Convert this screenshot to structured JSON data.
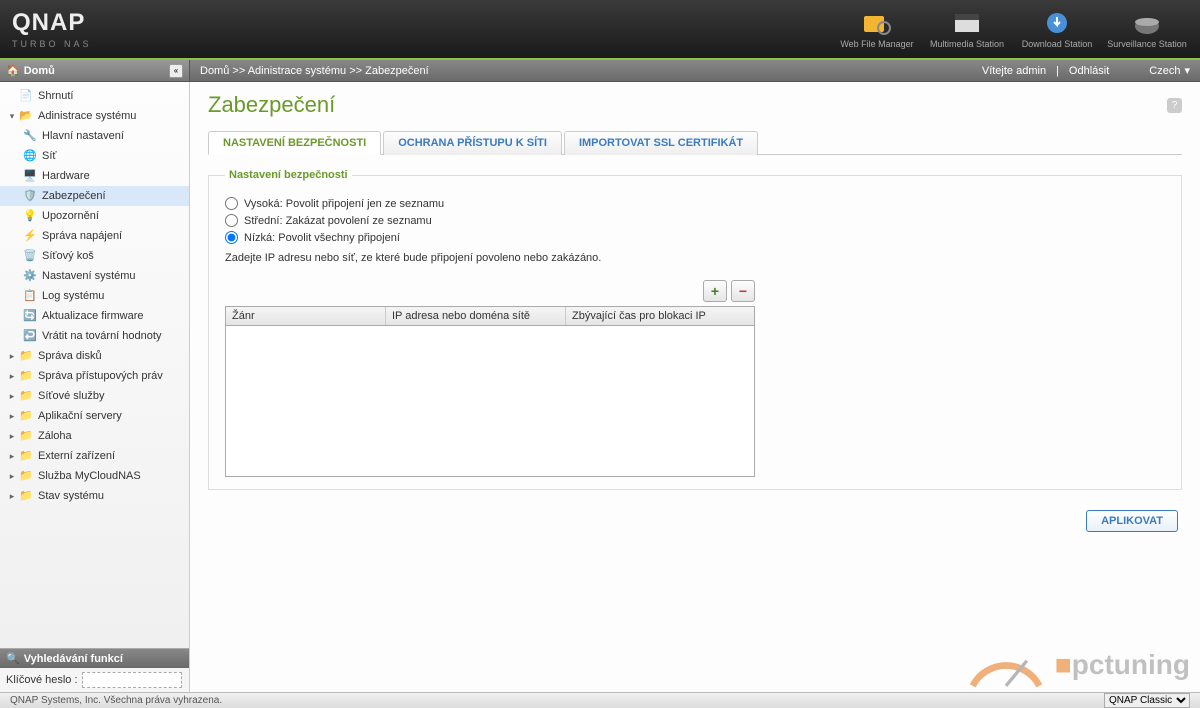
{
  "header": {
    "logo": "QNAP",
    "logo_sub": "TURBO NAS",
    "icons": [
      {
        "label": "Web File Manager"
      },
      {
        "label": "Multimedia Station"
      },
      {
        "label": "Download Station"
      },
      {
        "label": "Surveillance Station"
      }
    ]
  },
  "subheader": {
    "sidebar_title": "Domů",
    "breadcrumb": [
      "Domů",
      "Adinistrace systému",
      "Zabezpečení"
    ],
    "welcome": "Vítejte admin",
    "logout": "Odhlásit",
    "language": "Czech"
  },
  "sidebar": {
    "items": [
      {
        "type": "node",
        "icon": "summary",
        "label": "Shrnutí"
      },
      {
        "type": "expanded",
        "icon": "folder",
        "label": "Adinistrace systému"
      },
      {
        "type": "child",
        "icon": "settings",
        "label": "Hlavní nastavení"
      },
      {
        "type": "child",
        "icon": "network",
        "label": "Síť"
      },
      {
        "type": "child",
        "icon": "hardware",
        "label": "Hardware"
      },
      {
        "type": "child",
        "icon": "security",
        "label": "Zabezpečení",
        "selected": true
      },
      {
        "type": "child",
        "icon": "alert",
        "label": "Upozornění"
      },
      {
        "type": "child",
        "icon": "power",
        "label": "Správa napájení"
      },
      {
        "type": "child",
        "icon": "trash",
        "label": "Síťový koš"
      },
      {
        "type": "child",
        "icon": "system",
        "label": "Nastavení systému"
      },
      {
        "type": "child",
        "icon": "log",
        "label": "Log systému"
      },
      {
        "type": "child",
        "icon": "firmware",
        "label": "Aktualizace firmware"
      },
      {
        "type": "child",
        "icon": "reset",
        "label": "Vrátit na tovární hodnoty"
      },
      {
        "type": "collapsed",
        "icon": "folder",
        "label": "Správa disků"
      },
      {
        "type": "collapsed",
        "icon": "folder",
        "label": "Správa přístupových práv"
      },
      {
        "type": "collapsed",
        "icon": "folder",
        "label": "Síťové služby"
      },
      {
        "type": "collapsed",
        "icon": "folder",
        "label": "Aplikační servery"
      },
      {
        "type": "collapsed",
        "icon": "folder",
        "label": "Záloha"
      },
      {
        "type": "collapsed",
        "icon": "folder",
        "label": "Externí zařízení"
      },
      {
        "type": "collapsed",
        "icon": "folder",
        "label": "Služba MyCloudNAS"
      },
      {
        "type": "collapsed",
        "icon": "folder",
        "label": "Stav systému"
      }
    ],
    "search_title": "Vyhledávání funkcí",
    "search_label": "Klíčové heslo :",
    "search_value": ""
  },
  "content": {
    "title": "Zabezpečení",
    "tabs": [
      {
        "label": "NASTAVENÍ BEZPEČNOSTI",
        "active": true
      },
      {
        "label": "OCHRANA PŘÍSTUPU K SÍTI"
      },
      {
        "label": "IMPORTOVAT SSL CERTIFIKÁT"
      }
    ],
    "fieldset_title": "Nastavení bezpečnosti",
    "radios": [
      {
        "label": "Vysoká: Povolit připojení jen ze seznamu",
        "checked": false
      },
      {
        "label": "Střední: Zakázat povolení ze seznamu",
        "checked": false
      },
      {
        "label": "Nízká: Povolit všechny připojení",
        "checked": true
      }
    ],
    "hint": "Zadejte IP adresu nebo síť, ze které bude připojení povoleno nebo zakázáno.",
    "table_cols": [
      "Žánr",
      "IP adresa nebo doména sítě",
      "Zbývající čas pro blokaci IP"
    ],
    "apply": "APLIKOVAT"
  },
  "footer": {
    "copyright": "QNAP Systems, Inc. Všechna práva vyhrazena.",
    "theme": "QNAP Classic"
  },
  "watermark": {
    "brand": "pctuning"
  }
}
